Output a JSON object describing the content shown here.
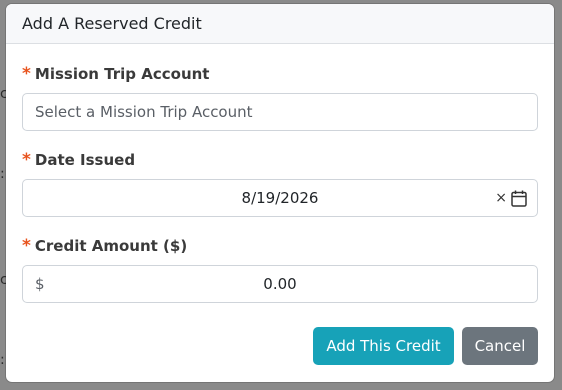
{
  "modal": {
    "title": "Add A Reserved Credit"
  },
  "form": {
    "account": {
      "label": "Mission Trip Account",
      "placeholder": "Select a Mission Trip Account",
      "required": true
    },
    "date": {
      "label": "Date Issued",
      "value": "8/19/2026",
      "clear_glyph": "×",
      "required": true
    },
    "amount": {
      "label": "Credit Amount ($)",
      "currency_symbol": "$",
      "value": "0.00",
      "required": true
    }
  },
  "actions": {
    "submit_label": "Add This Credit",
    "cancel_label": "Cancel"
  },
  "colors": {
    "required_star": "#e8541e",
    "primary_button": "#17a2b8",
    "secondary_button": "#6c757d"
  },
  "icons": {
    "required": "asterisk-icon",
    "clear": "clear-icon",
    "calendar": "calendar-icon"
  }
}
